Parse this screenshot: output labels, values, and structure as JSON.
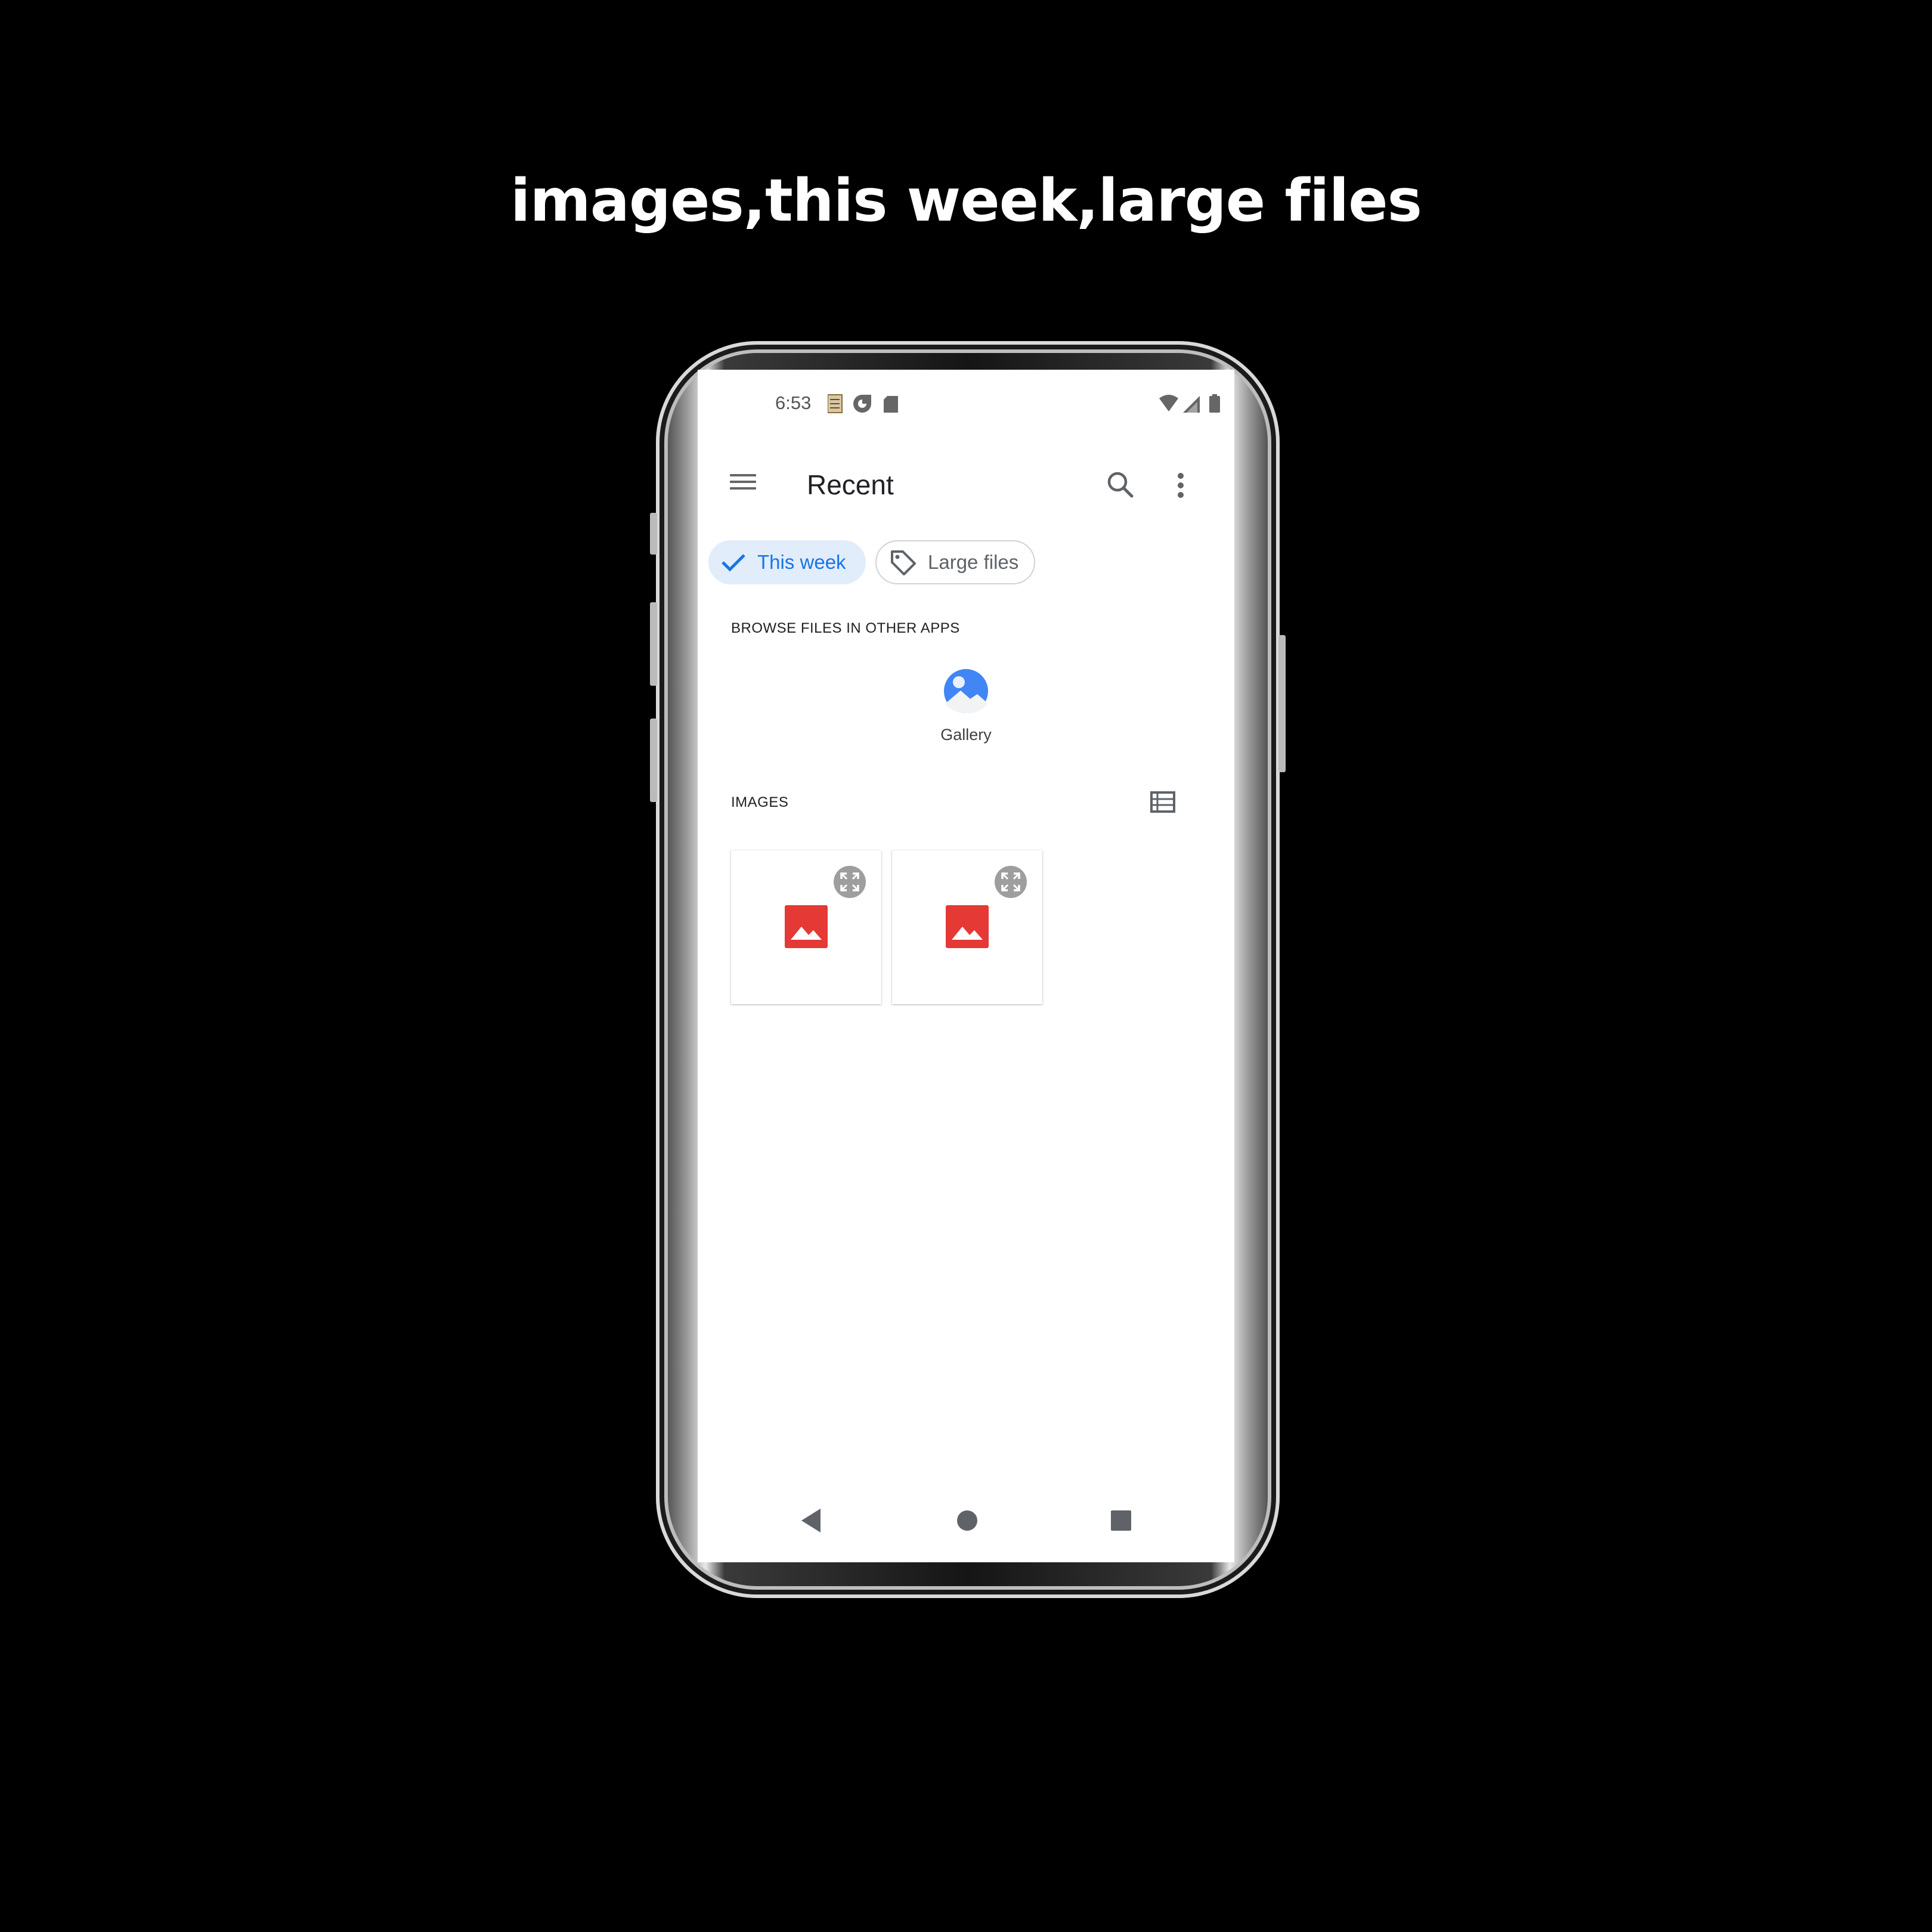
{
  "caption": "images,this week,large files",
  "status_bar": {
    "time": "6:53",
    "left_icons": [
      "notes-icon",
      "data-saver-icon",
      "sd-card-icon"
    ],
    "right_icons": [
      "wifi-icon",
      "cell-signal-icon",
      "battery-icon"
    ]
  },
  "app_bar": {
    "title": "Recent",
    "menu_icon": "hamburger-menu-icon",
    "search_icon": "search-icon",
    "more_icon": "more-vert-icon"
  },
  "chips": [
    {
      "label": "This week",
      "selected": true,
      "icon": "check-icon"
    },
    {
      "label": "Large files",
      "selected": false,
      "icon": "tag-icon"
    }
  ],
  "browse_section": {
    "header": "BROWSE FILES IN OTHER APPS",
    "apps": [
      {
        "label": "Gallery",
        "icon": "gallery-icon"
      }
    ]
  },
  "images_section": {
    "header": "IMAGES",
    "view_toggle_icon": "list-view-icon",
    "tiles": [
      {
        "icon": "image-icon",
        "overlay_icon": "expand-icon"
      },
      {
        "icon": "image-icon",
        "overlay_icon": "expand-icon"
      }
    ]
  },
  "nav_bar": [
    "back-icon",
    "home-icon",
    "recents-icon"
  ],
  "colors": {
    "accent": "#1a73e8",
    "chip_selected_bg": "#e1edfa",
    "image_icon": "#e53935",
    "gallery_blue": "#4285f4"
  }
}
